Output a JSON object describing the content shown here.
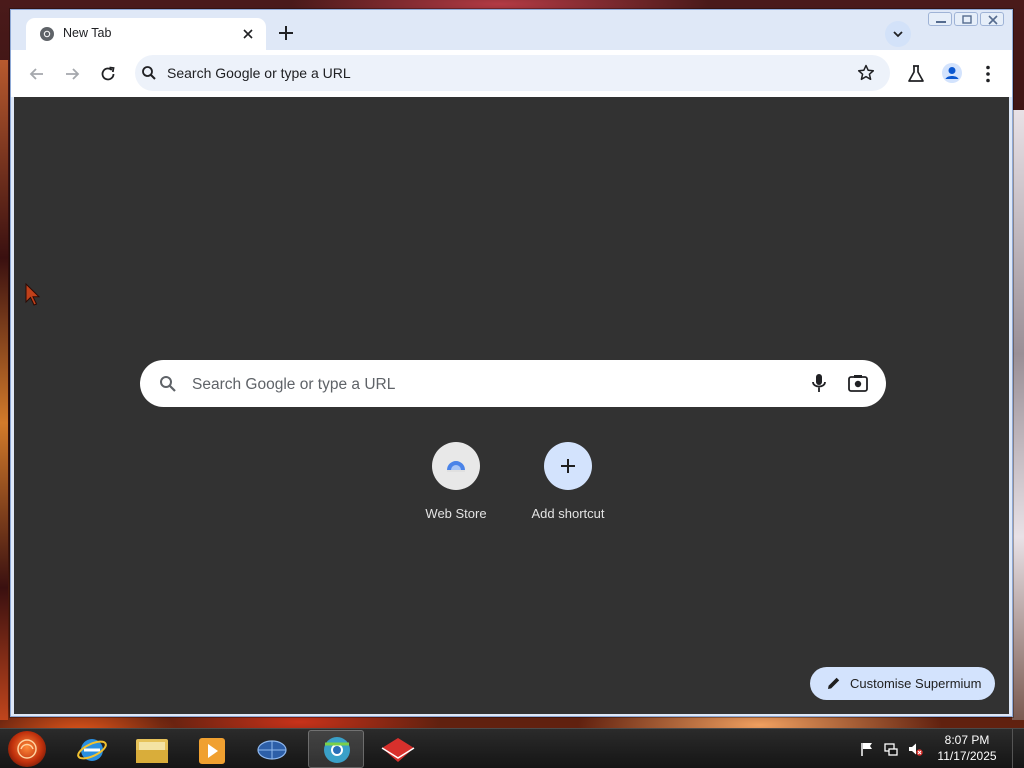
{
  "window": {
    "tab": {
      "title": "New Tab"
    },
    "toolbar": {
      "omnibox_text": "Search Google or type a URL"
    }
  },
  "ntp": {
    "search_placeholder": "Search Google or type a URL",
    "shortcuts": [
      {
        "label": "Web Store",
        "icon": "web-store-icon"
      },
      {
        "label": "Add shortcut",
        "icon": "plus-icon"
      }
    ],
    "customise_label": "Customise Supermium"
  },
  "taskbar": {
    "apps": [
      "internet-explorer",
      "file-explorer",
      "media-player",
      "network-app",
      "browser-active",
      "app-red"
    ],
    "clock": {
      "time": "8:07 PM",
      "date": "11/17/2025"
    }
  },
  "colors": {
    "content_bg": "#323232",
    "tab_strip": "#dfe8f7",
    "customise_bg": "#d3e3fd",
    "omnibox_bg": "#edf2fa"
  }
}
